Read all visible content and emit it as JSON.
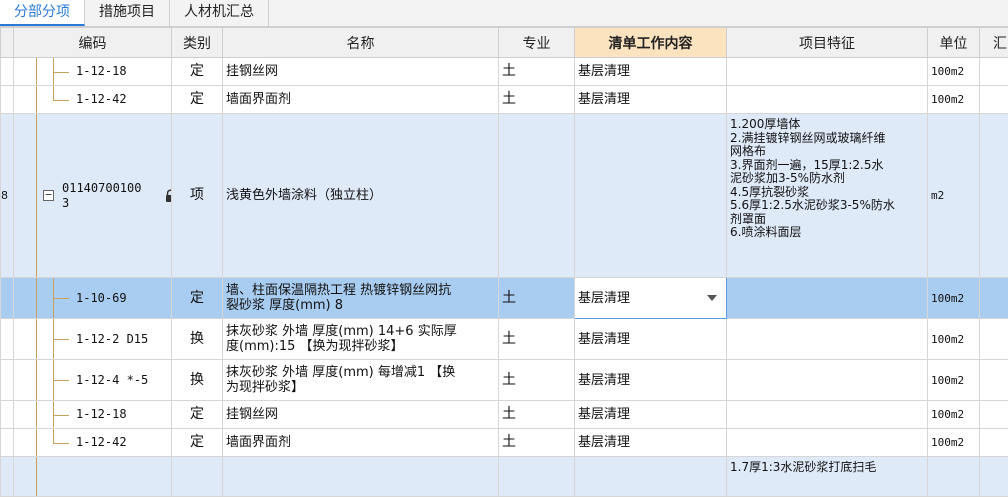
{
  "tabs": [
    {
      "label": "分部分项",
      "active": true
    },
    {
      "label": "措施项目",
      "active": false
    },
    {
      "label": "人材机汇总",
      "active": false
    }
  ],
  "columns": {
    "code": "编码",
    "type": "类别",
    "name": "名称",
    "spec": "专业",
    "work": "清单工作内容",
    "feature": "项目特征",
    "unit": "单位",
    "extra": "汇"
  },
  "rows": [
    {
      "code": "1-12-18",
      "type": "定",
      "name": "挂钢丝网",
      "spec": "土",
      "work": "基层清理",
      "feature": "",
      "unit": "100m2"
    },
    {
      "code": "1-12-42",
      "type": "定",
      "name": "墙面界面剂",
      "spec": "土",
      "work": "基层清理",
      "feature": "",
      "unit": "100m2"
    },
    {
      "row_no": "8",
      "code_line1": "01140700100",
      "code_line2": "3",
      "type": "项",
      "name": "浅黄色外墙涂料（独立柱）",
      "spec": "",
      "work": "",
      "feature": [
        "1.200厚墙体",
        "2.满挂镀锌钢丝网或玻璃纤维",
        "网格布",
        "3.界面剂一遍，15厚1:2.5水",
        "泥砂浆加3-5%防水剂",
        "4.5厚抗裂砂浆",
        "5.6厚1:2.5水泥砂浆3-5%防水",
        "剂罩面",
        "6.喷涂料面层"
      ],
      "unit": "m2"
    },
    {
      "code": "1-10-69",
      "type": "定",
      "name_line1": "墙、柱面保温隔热工程 热镀锌钢丝网抗",
      "name_line2": "裂砂浆 厚度(mm) 8",
      "spec": "土",
      "work": "基层清理",
      "feature": "",
      "unit": "100m2"
    },
    {
      "code": "1-12-2 D15",
      "type": "换",
      "name_line1": "抹灰砂浆 外墙 厚度(mm) 14+6  实际厚",
      "name_line2": "度(mm):15  【换为现拌砂浆】",
      "spec": "土",
      "work": "基层清理",
      "feature": "",
      "unit": "100m2"
    },
    {
      "code": "1-12-4 *-5",
      "type": "换",
      "name_line1": "抹灰砂浆 外墙 厚度(mm) 每增减1  【换",
      "name_line2": "为现拌砂浆】",
      "spec": "土",
      "work": "基层清理",
      "feature": "",
      "unit": "100m2"
    },
    {
      "code": "1-12-18",
      "type": "定",
      "name": "挂钢丝网",
      "spec": "土",
      "work": "基层清理",
      "feature": "",
      "unit": "100m2"
    },
    {
      "code": "1-12-42",
      "type": "定",
      "name": "墙面界面剂",
      "spec": "土",
      "work": "基层清理",
      "feature": "",
      "unit": "100m2"
    },
    {
      "code": "",
      "type": "",
      "name": "",
      "spec": "",
      "work": "",
      "feature": "1.7厚1:3水泥砂浆打底扫毛",
      "unit": ""
    }
  ],
  "colors": {
    "accent": "#2a7ad8",
    "item_row": "#dfeaf9",
    "selected_row": "#a9cdf1",
    "header_highlight": "#fbe3bf"
  },
  "icons": {
    "lock": "lock-icon",
    "collapse": "collapse-minus-icon",
    "dropdown": "chevron-down-icon"
  }
}
